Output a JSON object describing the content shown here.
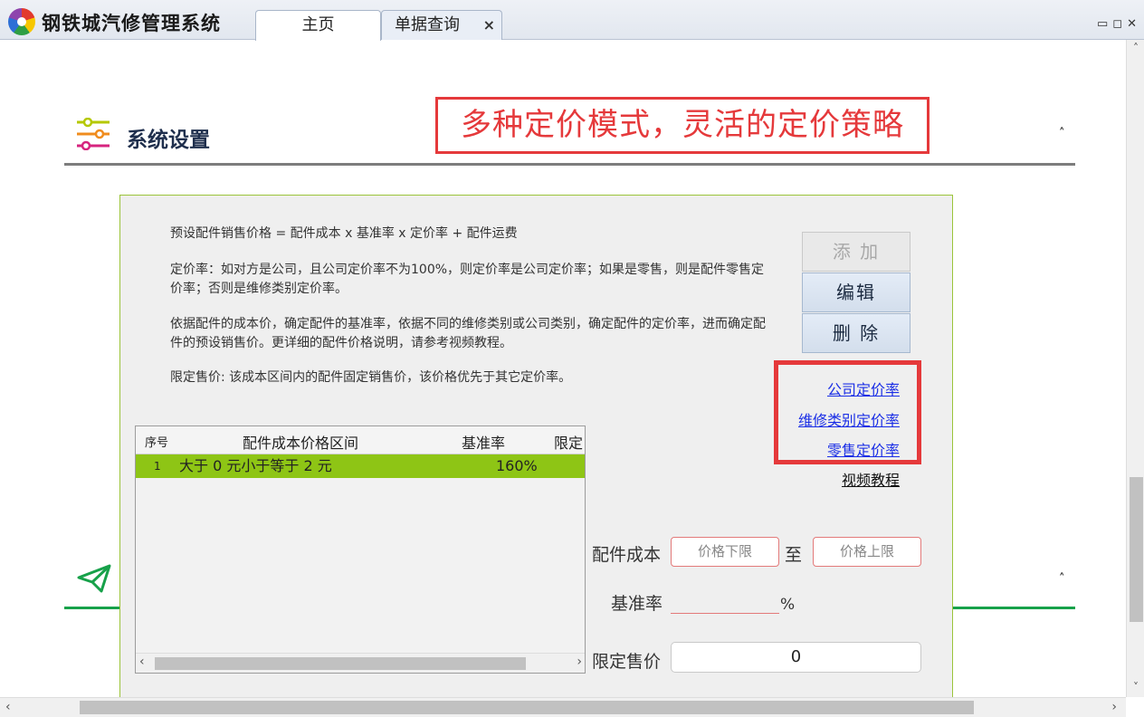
{
  "app": {
    "title": "钢铁城汽修管理系统"
  },
  "tabs": [
    {
      "label": "主页",
      "active": true
    },
    {
      "label": "单据查询",
      "active": false,
      "close": "×"
    }
  ],
  "window_controls": [
    "▭",
    "◻",
    "✕"
  ],
  "sections": {
    "settings": {
      "title": "系统设置",
      "icon": "sliders-icon",
      "collapse": "˄"
    },
    "second": {
      "icon": "paper-plane-icon",
      "collapse": "˄"
    }
  },
  "callout": "多种定价模式，灵活的定价策略",
  "panel": {
    "desc": [
      "预设配件销售价格 = 配件成本 x 基准率  x 定价率 + 配件运费",
      "定价率：如对方是公司，且公司定价率不为100%，则定价率是公司定价率；如果是零售，则是配件零售定价率；否则是维修类别定价率。",
      "依据配件的成本价，确定配件的基准率，依据不同的维修类别或公司类别，确定配件的定价率，进而确定配件的预设销售价。更详细的配件价格说明，请参考视频教程。",
      "限定售价: 该成本区间内的配件固定销售价，该价格优先于其它定价率。"
    ],
    "buttons": {
      "add": "添 加",
      "edit": "编辑",
      "delete": "删 除"
    },
    "links": {
      "company": "公司定价率",
      "repair": "维修类别定价率",
      "retail": "零售定价率",
      "video": "视频教程"
    },
    "grid": {
      "columns": [
        "序号",
        "配件成本价格区间",
        "基准率",
        "限定"
      ],
      "rows": [
        {
          "index": "1",
          "range": "大于 0 元小于等于 2 元",
          "rate": "160%",
          "limit": ""
        }
      ]
    },
    "form": {
      "cost_label": "配件成本",
      "min_placeholder": "价格下限",
      "to": "至",
      "max_placeholder": "价格上限",
      "rate_label": "基准率",
      "rate_value": "",
      "percent": "%",
      "limit_label": "限定售价",
      "limit_value": "0"
    }
  },
  "colors": {
    "accent_red": "#e5393b",
    "row_highlight": "#8ec515",
    "green_rule": "#17a14a",
    "link": "#1b2fe6"
  }
}
